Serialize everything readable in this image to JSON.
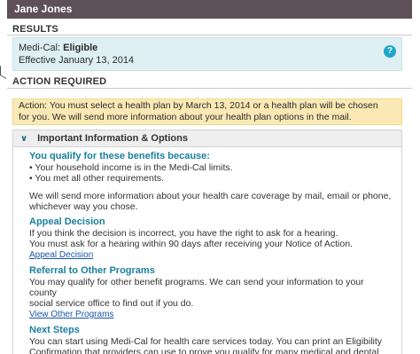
{
  "header": {
    "name": "Jane Jones"
  },
  "results": {
    "label": "RESULTS",
    "program": "Medi-Cal:",
    "status": "Eligible",
    "effective": "Effective January 13, 2014",
    "help_icon": "?"
  },
  "action": {
    "label": "ACTION REQUIRED",
    "line1": "Action: You must select a health plan by March 13, 2014 or a health plan will be chosen",
    "line2": "for you. We will send more information about your health plan options in the mail."
  },
  "panel": {
    "chevron": "∨",
    "title": "Important Information & Options",
    "qualify_heading": "You qualify for these benefits because:",
    "qualify_items": [
      "• Your household income is in the Medi-Cal limits.",
      "• You met all other requirements."
    ],
    "coverage_line1": "We will send more information about your health care coverage by mail, email or phone,",
    "coverage_line2": "whichever way you chose.",
    "appeal_heading": "Appeal Decision",
    "appeal_line1": "If you think the decision is incorrect, you have the right to ask for a hearing.",
    "appeal_line2": "You must ask for a hearing within 90 days after receiving your Notice of Action.",
    "appeal_link": "Appeal Decision",
    "referral_heading": "Referral to Other Programs",
    "referral_line1": "You may qualify for other benefit programs. We can send your information to your county",
    "referral_line2": "social service office to find out if you do.",
    "referral_link": "View Other Programs",
    "next_heading": "Next Steps",
    "next_line1": "You can start using Medi-Cal for health care services today. You can print an Eligibility",
    "next_line2": "Confirmation that providers can use to prove you qualify for many medical and dental"
  }
}
